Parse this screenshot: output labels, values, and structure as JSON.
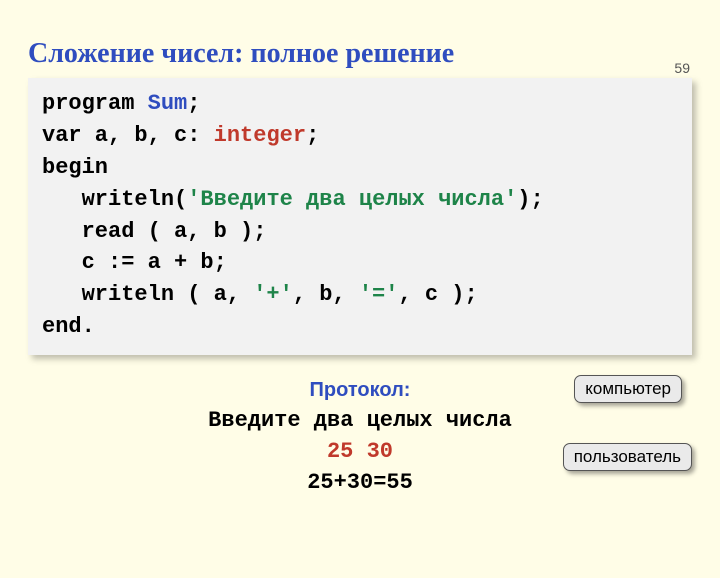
{
  "page_number": "59",
  "title": "Сложение чисел: полное решение",
  "code": {
    "l1_a": "program ",
    "l1_b": "Sum",
    "l1_c": ";",
    "l2_a": "var a, b, c: ",
    "l2_b": "integer",
    "l2_c": ";",
    "l3": "begin",
    "l4_a": "   writeln(",
    "l4_b": "'Введите два целых числа'",
    "l4_c": ");",
    "l5": "   read ( a, b );",
    "l6": "   c := a + b;",
    "l7_a": "   writeln ( a, ",
    "l7_b": "'+'",
    "l7_c": ", b, ",
    "l7_d": "'='",
    "l7_e": ", c );",
    "l8": "end."
  },
  "protocol": {
    "label": "Протокол:",
    "line1": "Введите два целых числа",
    "line2": "25 30",
    "line3": "25+30=55"
  },
  "callouts": {
    "computer": "компьютер",
    "user": "пользователь"
  }
}
